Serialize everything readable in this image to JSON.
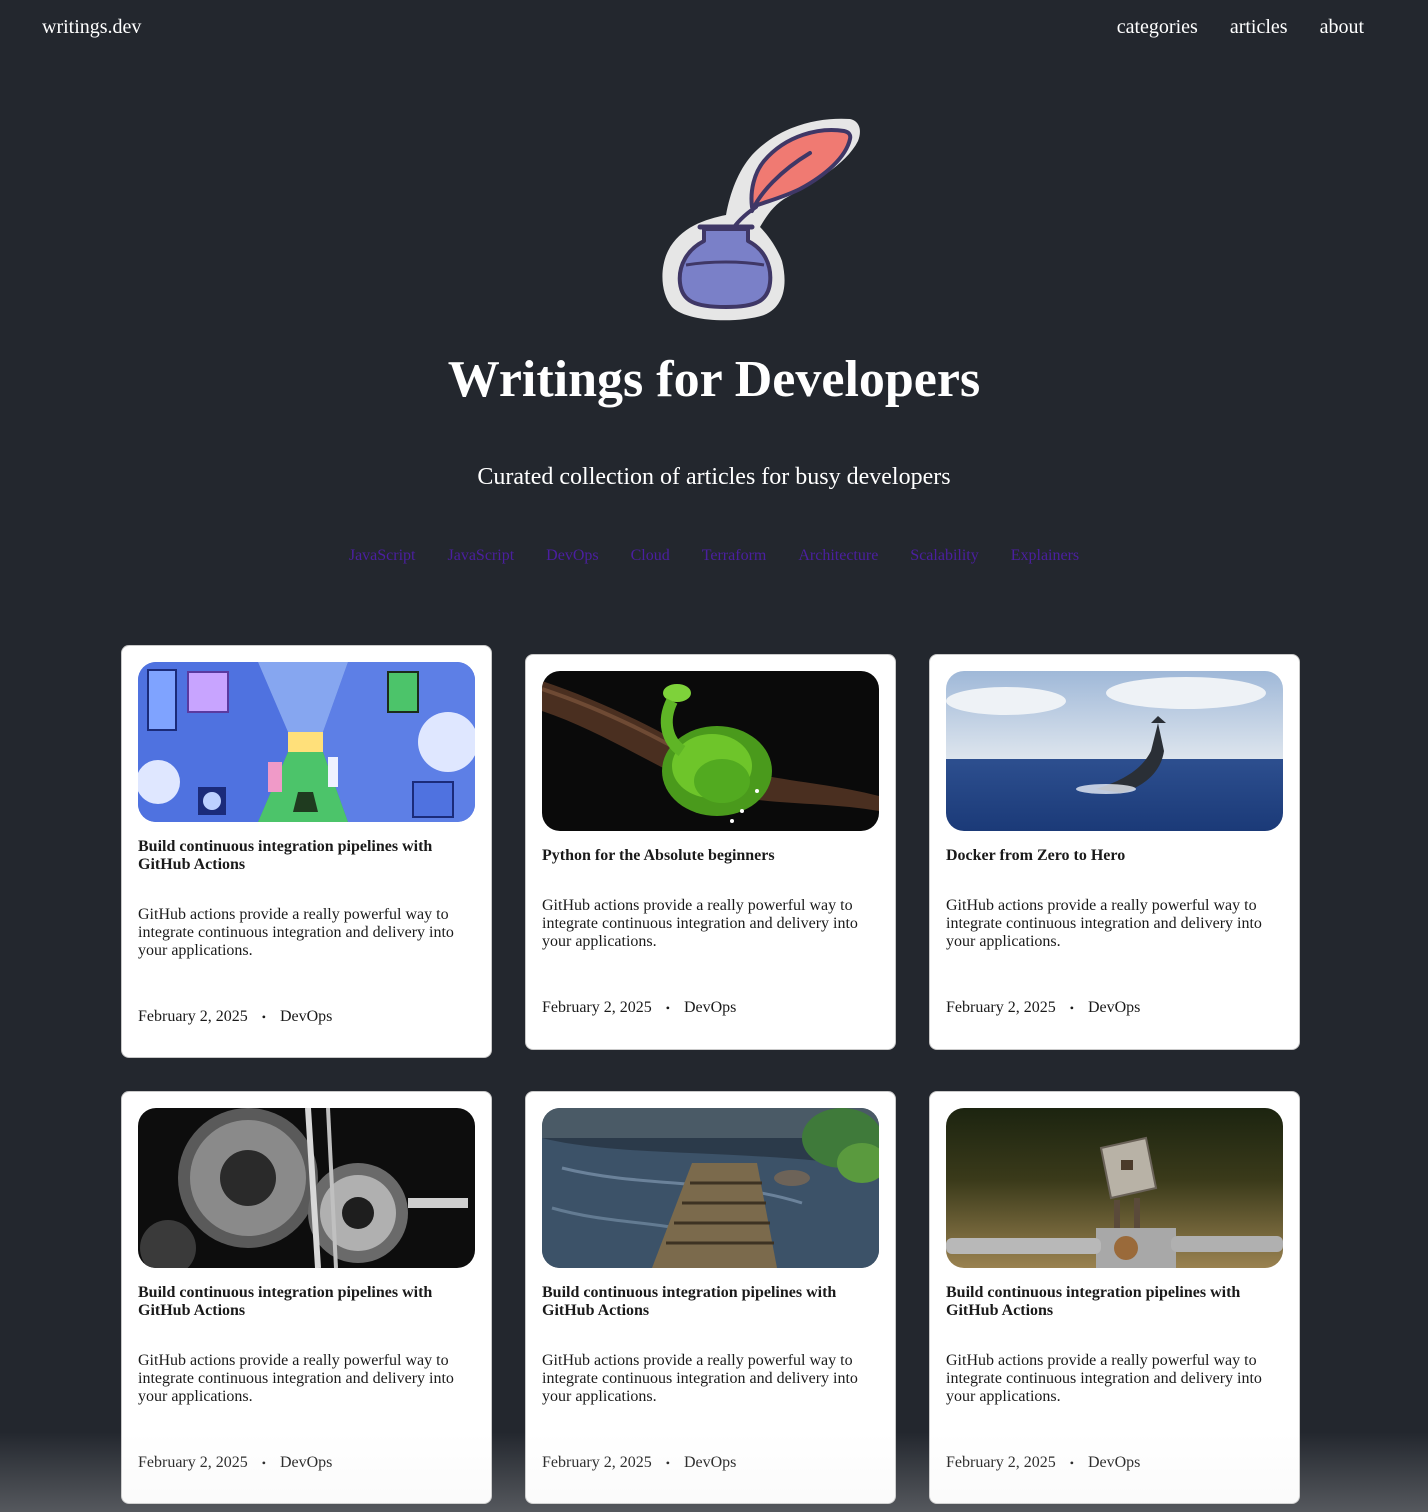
{
  "nav": {
    "brand": "writings.dev",
    "links": [
      "categories",
      "articles",
      "about"
    ]
  },
  "hero": {
    "title": "Writings for Developers",
    "subtitle": "Curated collection of articles for busy developers",
    "logo_icon": "quill-inkpot-icon"
  },
  "categories": [
    "JavaScript",
    "JavaScript",
    "DevOps",
    "Cloud",
    "Terraform",
    "Architecture",
    "Scalability",
    "Explainers"
  ],
  "colors": {
    "background": "#23272e",
    "category_link": "#4b1fa0",
    "card": "#ffffff"
  },
  "cards": [
    {
      "title": "Build continuous integration pipelines with GitHub Actions",
      "description": "GitHub actions provide a really powerful way to integrate continuous integration and delivery into your applications.",
      "date": "February 2, 2025",
      "separator": "•",
      "category": "DevOps",
      "image": "abstract-corridor-art"
    },
    {
      "title": "Python for the Absolute beginners",
      "description": "GitHub actions provide a really powerful way to integrate continuous integration and delivery into your applications.",
      "date": "February 2, 2025",
      "separator": "•",
      "category": "DevOps",
      "image": "green-python-snake"
    },
    {
      "title": "Docker from Zero to Hero",
      "description": "GitHub actions provide a really powerful way to integrate continuous integration and delivery into your applications.",
      "date": "February 2, 2025",
      "separator": "•",
      "category": "DevOps",
      "image": "whale-tail-ocean"
    },
    {
      "title": "Build continuous integration pipelines with GitHub Actions",
      "description": "GitHub actions provide a really powerful way to integrate continuous integration and delivery into your applications.",
      "date": "February 2, 2025",
      "separator": "•",
      "category": "DevOps",
      "image": "mechanical-gears"
    },
    {
      "title": "Build continuous integration pipelines with GitHub Actions",
      "description": "GitHub actions provide a really powerful way to integrate continuous integration and delivery into your applications.",
      "date": "February 2, 2025",
      "separator": "•",
      "category": "DevOps",
      "image": "wooden-bridge-river"
    },
    {
      "title": "Build continuous integration pipelines with GitHub Actions",
      "description": "GitHub actions provide a really powerful way to integrate continuous integration and delivery into your applications.",
      "date": "February 2, 2025",
      "separator": "•",
      "category": "DevOps",
      "image": "scrap-metal-robot"
    }
  ]
}
